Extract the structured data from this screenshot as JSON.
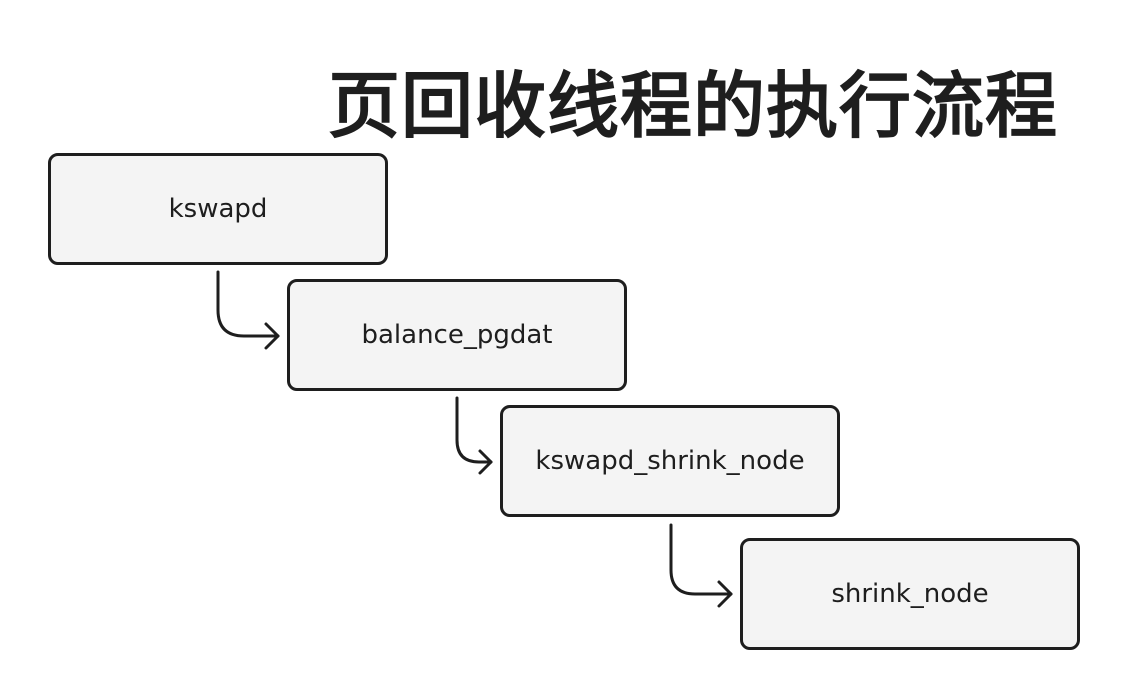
{
  "diagram": {
    "title": "页回收线程的执行流程",
    "nodes": [
      {
        "id": "n1",
        "label": "kswapd"
      },
      {
        "id": "n2",
        "label": "balance_pgdat"
      },
      {
        "id": "n3",
        "label": "kswapd_shrink_node"
      },
      {
        "id": "n4",
        "label": "shrink_node"
      }
    ],
    "edges": [
      {
        "from": "n1",
        "to": "n2"
      },
      {
        "from": "n2",
        "to": "n3"
      },
      {
        "from": "n3",
        "to": "n4"
      }
    ],
    "colors": {
      "node_fill": "#f4f4f4",
      "stroke": "#1e1e1e",
      "background": "#ffffff"
    }
  }
}
